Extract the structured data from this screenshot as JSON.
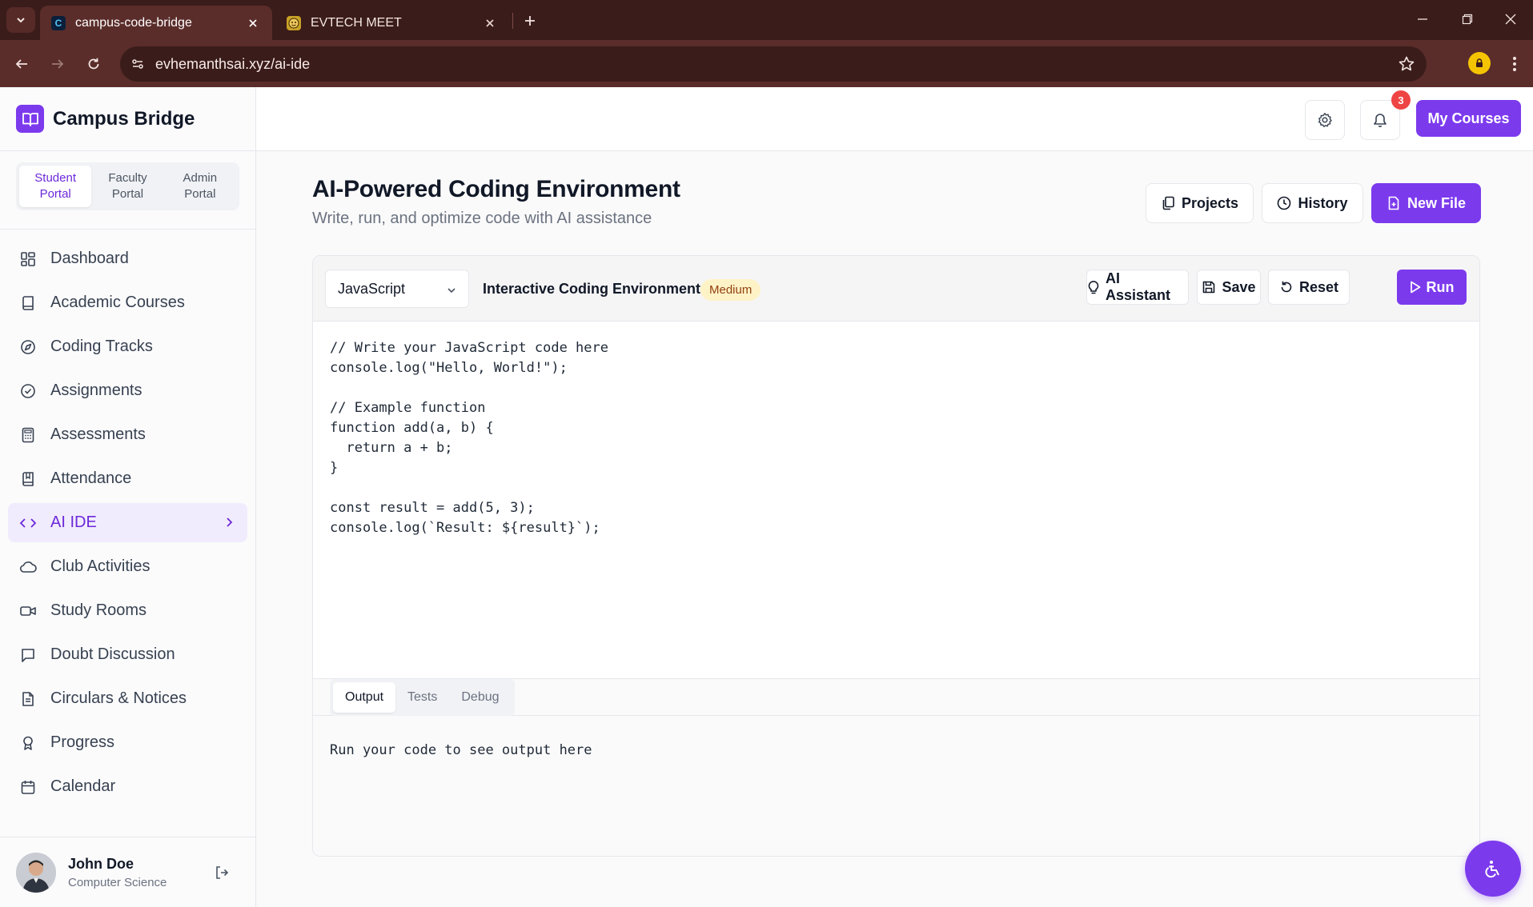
{
  "browser": {
    "tabs": [
      {
        "title": "campus-code-bridge",
        "favicon": "C",
        "active": true
      },
      {
        "title": "EVTECH MEET",
        "favicon": "emoji-face",
        "active": false
      }
    ],
    "url": "evhemanthsai.xyz/ai-ide",
    "colors": {
      "frame": "#3a1c1a",
      "toolbar": "#5a2d2a"
    }
  },
  "sidebar": {
    "brand": "Campus Bridge",
    "portals": [
      {
        "label": "Student\nPortal",
        "active": true
      },
      {
        "label": "Faculty\nPortal",
        "active": false
      },
      {
        "label": "Admin\nPortal",
        "active": false
      }
    ],
    "nav": [
      {
        "label": "Dashboard",
        "icon": "dashboard-icon"
      },
      {
        "label": "Academic Courses",
        "icon": "book-icon"
      },
      {
        "label": "Coding Tracks",
        "icon": "compass-icon"
      },
      {
        "label": "Assignments",
        "icon": "check-circle-icon"
      },
      {
        "label": "Assessments",
        "icon": "calculator-icon"
      },
      {
        "label": "Attendance",
        "icon": "bookmark-book-icon"
      },
      {
        "label": "AI IDE",
        "icon": "code-icon",
        "active": true
      },
      {
        "label": "Club Activities",
        "icon": "cloud-icon"
      },
      {
        "label": "Study Rooms",
        "icon": "video-icon"
      },
      {
        "label": "Doubt Discussion",
        "icon": "message-icon"
      },
      {
        "label": "Circulars & Notices",
        "icon": "document-icon"
      },
      {
        "label": "Progress",
        "icon": "award-icon"
      },
      {
        "label": "Calendar",
        "icon": "calendar-icon"
      }
    ],
    "user": {
      "name": "John Doe",
      "department": "Computer Science"
    }
  },
  "topbar": {
    "notification_count": "3",
    "my_courses_label": "My Courses"
  },
  "page": {
    "title": "AI-Powered Coding Environment",
    "subtitle": "Write, run, and optimize code with AI assistance",
    "projects_label": "Projects",
    "history_label": "History",
    "new_file_label": "New File"
  },
  "editor": {
    "language": "JavaScript",
    "environment_title": "Interactive Coding Environment",
    "difficulty": "Medium",
    "ai_assistant_label": "AI Assistant",
    "save_label": "Save",
    "reset_label": "Reset",
    "run_label": "Run",
    "code_lines": [
      "// Write your JavaScript code here",
      "console.log(\"Hello, World!\");",
      "",
      "// Example function",
      "function add(a, b) {",
      "  return a + b;",
      "}",
      "",
      "const result = add(5, 3);",
      "console.log(`Result: ${result}`);"
    ],
    "output_tabs": [
      "Output",
      "Tests",
      "Debug"
    ],
    "output_placeholder": "Run your code to see output here"
  },
  "theme": {
    "accent": "#7c3aed",
    "badge": "#ef4444"
  }
}
